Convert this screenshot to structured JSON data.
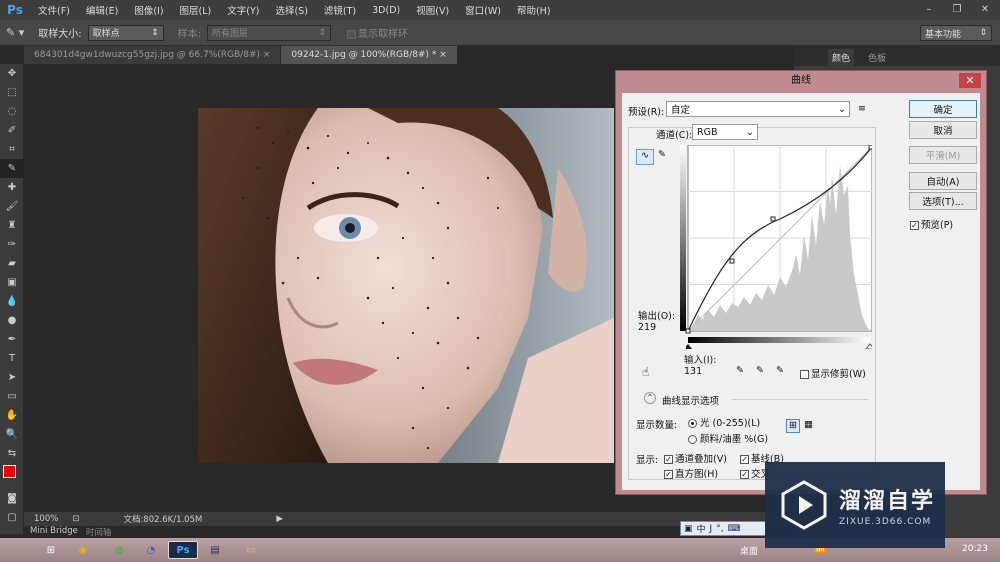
{
  "app": {
    "logo": "Ps"
  },
  "menu": [
    "文件(F)",
    "编辑(E)",
    "图像(I)",
    "图层(L)",
    "文字(Y)",
    "选择(S)",
    "滤镜(T)",
    "3D(D)",
    "视图(V)",
    "窗口(W)",
    "帮助(H)"
  ],
  "options": {
    "sample_size_label": "取样大小:",
    "sample_size_value": "取样点",
    "sample_label": "样本:",
    "sample_value": "所有图层",
    "show_ring": "显示取样环"
  },
  "workspace": "基本功能",
  "tabs": [
    {
      "label": "684301d4gw1dwuzcg55gzj.jpg @ 66.7%(RGB/8#)",
      "close": "×"
    },
    {
      "label": "09242-1.jpg @ 100%(RGB/8#) *",
      "close": "×"
    }
  ],
  "status": {
    "zoom": "100%",
    "doc": "文档:802.6K/1.05M"
  },
  "bottom_tabs": [
    "Mini Bridge",
    "时间轴"
  ],
  "right_panel": {
    "tabs": [
      "颜色",
      "色板"
    ]
  },
  "dialog": {
    "title": "曲线",
    "preset_label": "预设(R):",
    "preset_value": "自定",
    "channel_label": "通道(C):",
    "channel_value": "RGB",
    "output_label": "输出(O):",
    "output_value": "219",
    "input_label": "输入(I):",
    "input_value": "131",
    "show_clipping": "显示修剪(W)",
    "display_options": "曲线显示选项",
    "show_amount_label": "显示数量:",
    "light_option": "光 (0-255)(L)",
    "pigment_option": "颜料/油墨 %(G)",
    "show_label": "显示:",
    "channel_overlay": "通道叠加(V)",
    "baseline": "基线(B)",
    "histogram": "直方图(H)",
    "intersection": "交叉",
    "buttons": {
      "ok": "确定",
      "cancel": "取消",
      "smooth": "平滑(M)",
      "auto": "自动(A)",
      "options": "选项(T)..."
    },
    "preview": "预览(P)"
  },
  "taskbar": {
    "desktop": "桌面",
    "time": "20:23"
  },
  "ime": [
    "中",
    "J",
    "°,",
    "⌨"
  ],
  "watermark": {
    "title": "溜溜自学",
    "url": "ZIXUE.3D66.COM"
  },
  "colors": {
    "accent": "#4ea3f5",
    "dialog_frame": "#c08b8e",
    "close": "#c74343"
  }
}
